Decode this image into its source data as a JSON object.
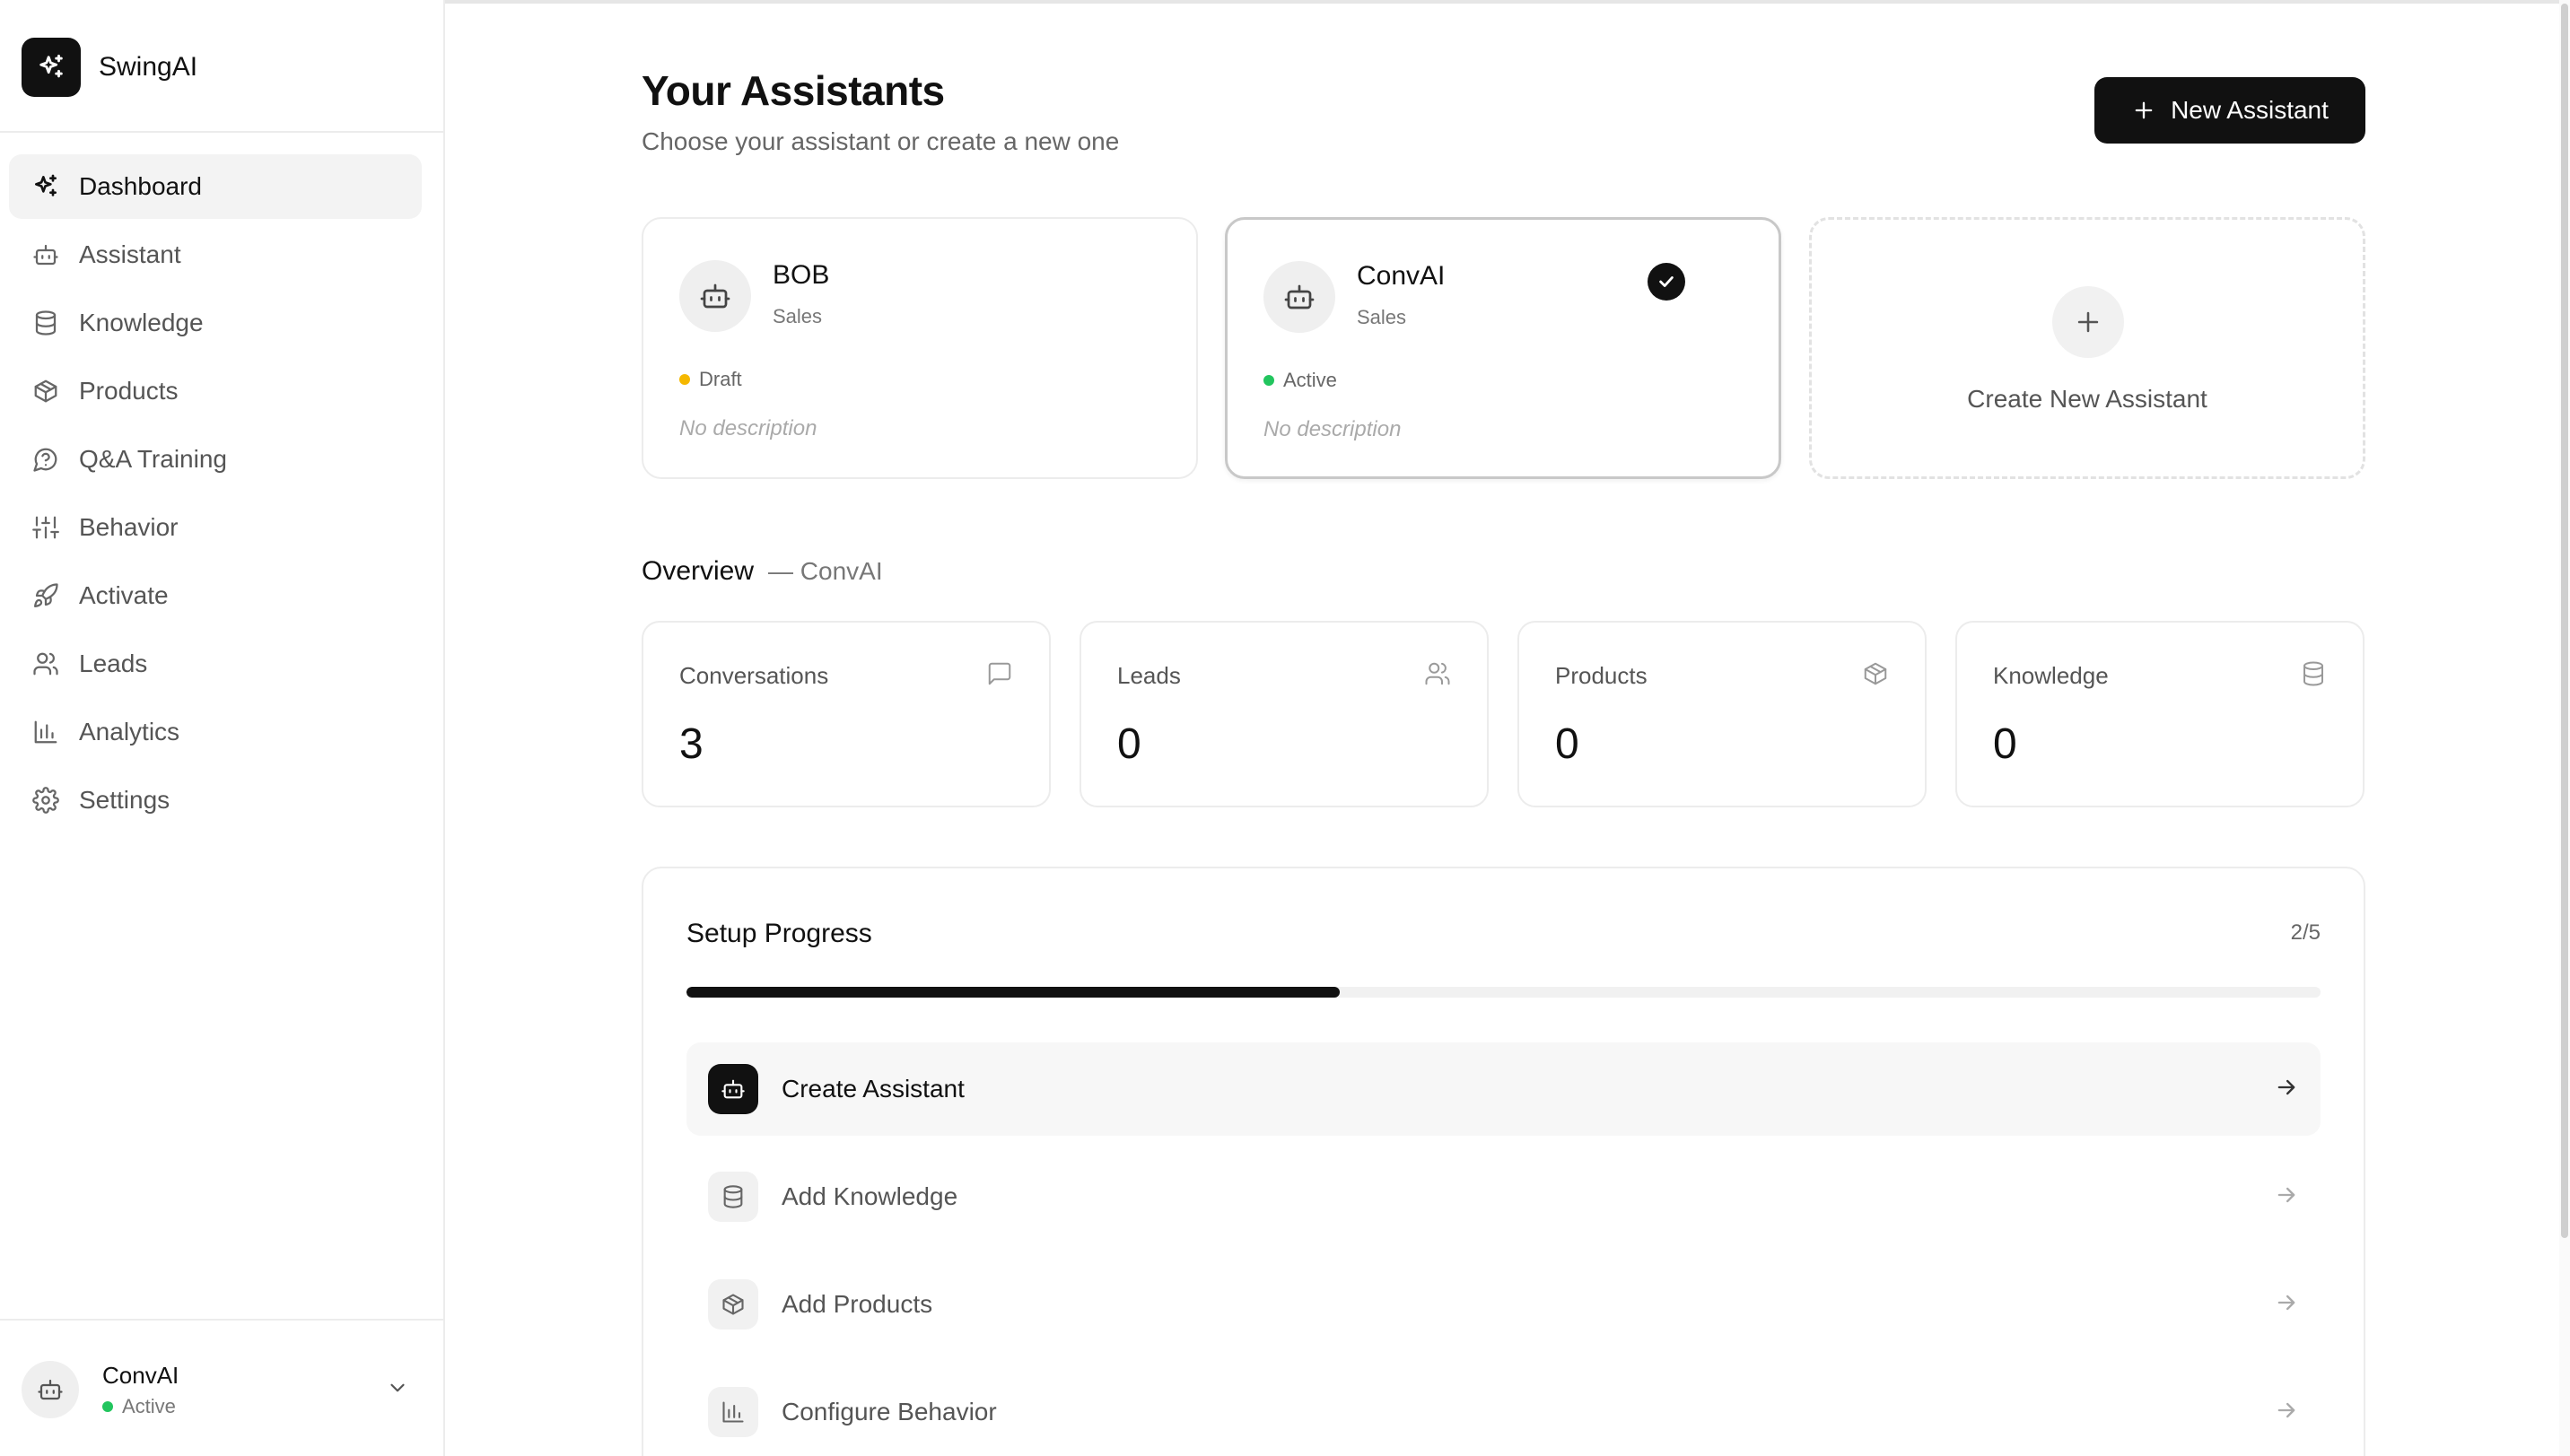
{
  "app": {
    "name": "SwingAI"
  },
  "sidebar": {
    "items": [
      {
        "label": "Dashboard",
        "icon": "sparkle-icon",
        "active": true
      },
      {
        "label": "Assistant",
        "icon": "bot-icon"
      },
      {
        "label": "Knowledge",
        "icon": "database-icon"
      },
      {
        "label": "Products",
        "icon": "box-icon"
      },
      {
        "label": "Q&A Training",
        "icon": "chat-help-icon"
      },
      {
        "label": "Behavior",
        "icon": "sliders-icon"
      },
      {
        "label": "Activate",
        "icon": "rocket-icon"
      },
      {
        "label": "Leads",
        "icon": "users-icon"
      },
      {
        "label": "Analytics",
        "icon": "bar-chart-icon"
      },
      {
        "label": "Settings",
        "icon": "gear-icon"
      }
    ],
    "account": {
      "name": "ConvAI",
      "status": "Active",
      "status_color": "#22c55e"
    }
  },
  "header": {
    "title": "Your Assistants",
    "subtitle": "Choose your assistant or create a new one",
    "new_button": "New Assistant"
  },
  "assistants": [
    {
      "name": "BOB",
      "role": "Sales",
      "status": "Draft",
      "status_color": "#f5b800",
      "description": "No description",
      "selected": false
    },
    {
      "name": "ConvAI",
      "role": "Sales",
      "status": "Active",
      "status_color": "#22c55e",
      "description": "No description",
      "selected": true
    }
  ],
  "create_card": {
    "label": "Create New Assistant"
  },
  "overview": {
    "title": "Overview",
    "subtitle": "— ConvAI",
    "stats": [
      {
        "label": "Conversations",
        "value": "3",
        "icon": "message-icon"
      },
      {
        "label": "Leads",
        "value": "0",
        "icon": "users-icon"
      },
      {
        "label": "Products",
        "value": "0",
        "icon": "box-icon"
      },
      {
        "label": "Knowledge",
        "value": "0",
        "icon": "database-icon"
      }
    ]
  },
  "setup": {
    "title": "Setup Progress",
    "count": "2/5",
    "progress_fraction": 0.4,
    "steps": [
      {
        "label": "Create Assistant",
        "icon": "bot-icon",
        "current": true
      },
      {
        "label": "Add Knowledge",
        "icon": "database-icon"
      },
      {
        "label": "Add Products",
        "icon": "box-icon"
      },
      {
        "label": "Configure Behavior",
        "icon": "bar-chart-icon"
      }
    ]
  },
  "colors": {
    "accent": "#111111",
    "border": "#ececec",
    "muted": "#777777"
  }
}
